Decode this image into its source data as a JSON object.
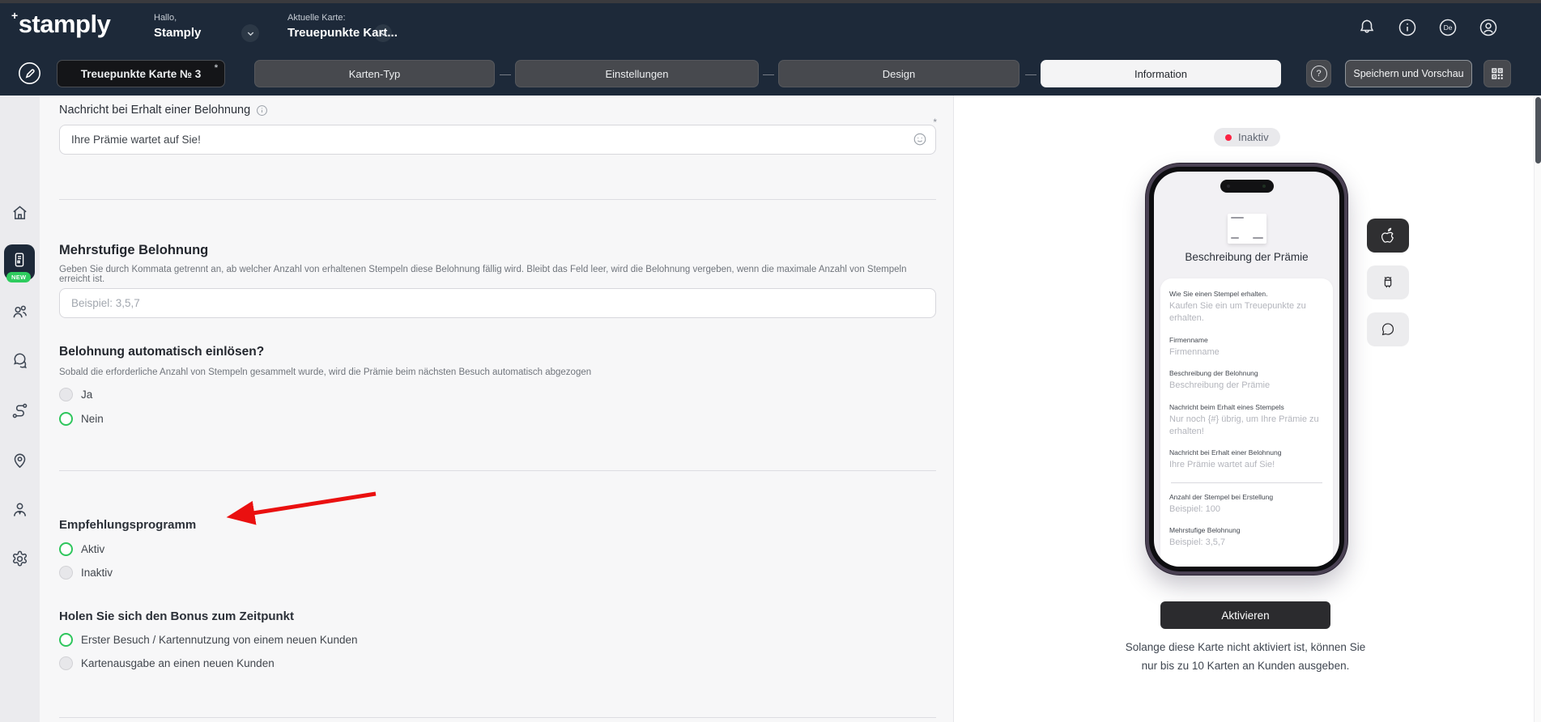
{
  "topbar": {
    "logo_plus": "+",
    "logo": "stamply",
    "greeting_label": "Hallo,",
    "greeting_name": "Stamply",
    "current_card_label": "Aktuelle Karte:",
    "current_card_name": "Treuepunkte Kart...",
    "language_badge": "De"
  },
  "stepbar": {
    "card_name": "Treuepunkte Karte № 3",
    "required_marker": "*",
    "separator": "—",
    "steps": [
      {
        "label": "Karten-Typ",
        "active": false
      },
      {
        "label": "Einstellungen",
        "active": false
      },
      {
        "label": "Design",
        "active": false
      },
      {
        "label": "Information",
        "active": true
      }
    ],
    "help_label": "?",
    "save_label": "Speichern und Vorschau"
  },
  "sidebar": {
    "new_badge": "NEW",
    "items": [
      {
        "icon": "home-icon"
      },
      {
        "icon": "loyalty-card-icon",
        "active": true
      },
      {
        "icon": "customers-icon"
      },
      {
        "icon": "messages-icon"
      },
      {
        "icon": "route-icon"
      },
      {
        "icon": "locations-icon"
      },
      {
        "icon": "manager-icon"
      },
      {
        "icon": "settings-icon"
      }
    ]
  },
  "form": {
    "reward_message": {
      "label": "Nachricht bei Erhalt einer Belohnung",
      "value": "Ihre Prämie wartet auf Sie!",
      "required_marker": "*"
    },
    "multilevel": {
      "title": "Mehrstufige Belohnung",
      "description": "Geben Sie durch Kommata getrennt an, ab welcher Anzahl von erhaltenen Stempeln diese Belohnung fällig wird. Bleibt das Feld leer, wird die Belohnung vergeben, wenn die maximale Anzahl von Stempeln erreicht ist.",
      "placeholder": "Beispiel: 3,5,7"
    },
    "auto_redeem": {
      "title": "Belohnung automatisch einlösen?",
      "description": "Sobald die erforderliche Anzahl von Stempeln gesammelt wurde, wird die Prämie beim nächsten Besuch automatisch abgezogen",
      "options": [
        {
          "label": "Ja",
          "selected": false
        },
        {
          "label": "Nein",
          "selected": true
        }
      ]
    },
    "referral": {
      "title": "Empfehlungsprogramm",
      "options": [
        {
          "label": "Aktiv",
          "selected": true
        },
        {
          "label": "Inaktiv",
          "selected": false
        }
      ]
    },
    "bonus_timing": {
      "title": "Holen Sie sich den Bonus zum Zeitpunkt",
      "options": [
        {
          "label": "Erster Besuch / Kartennutzung von einem neuen Kunden",
          "selected": true
        },
        {
          "label": "Kartenausgabe an einen neuen Kunden",
          "selected": false
        }
      ]
    }
  },
  "preview": {
    "status": "Inaktiv",
    "card_title": "Beschreibung der Prämie",
    "fields": [
      {
        "label": "Wie Sie einen Stempel erhalten.",
        "value": "Kaufen Sie ein um Treuepunkte zu erhalten."
      },
      {
        "label": "Firmenname",
        "value": "Firmenname"
      },
      {
        "label": "Beschreibung der Belohnung",
        "value": "Beschreibung der Prämie"
      },
      {
        "label": "Nachricht beim Erhalt eines Stempels",
        "value": "Nur noch {#} übrig, um Ihre Prämie zu erhalten!"
      },
      {
        "label": "Nachricht bei Erhalt einer Belohnung",
        "value": "Ihre Prämie wartet auf Sie!"
      },
      {
        "label": "Anzahl der Stempel bei Erstellung",
        "value": "Beispiel: 100"
      },
      {
        "label": "Mehrstufige Belohnung",
        "value": "Beispiel: 3,5,7"
      }
    ],
    "os_buttons": [
      {
        "icon": "apple-icon",
        "active": true
      },
      {
        "icon": "android-icon",
        "active": false
      },
      {
        "icon": "chat-icon",
        "active": false
      }
    ],
    "activate_button": "Aktivieren",
    "note": "Solange diese Karte nicht aktiviert ist, können Sie nur bis zu 10 Karten an Kunden ausgeben."
  },
  "colors": {
    "navbar": "#1d2939",
    "accent_green": "#2fc65d",
    "status_red": "#fb2343",
    "arrow_red": "#ea1010",
    "new_badge_green": "#2ecc5e"
  }
}
